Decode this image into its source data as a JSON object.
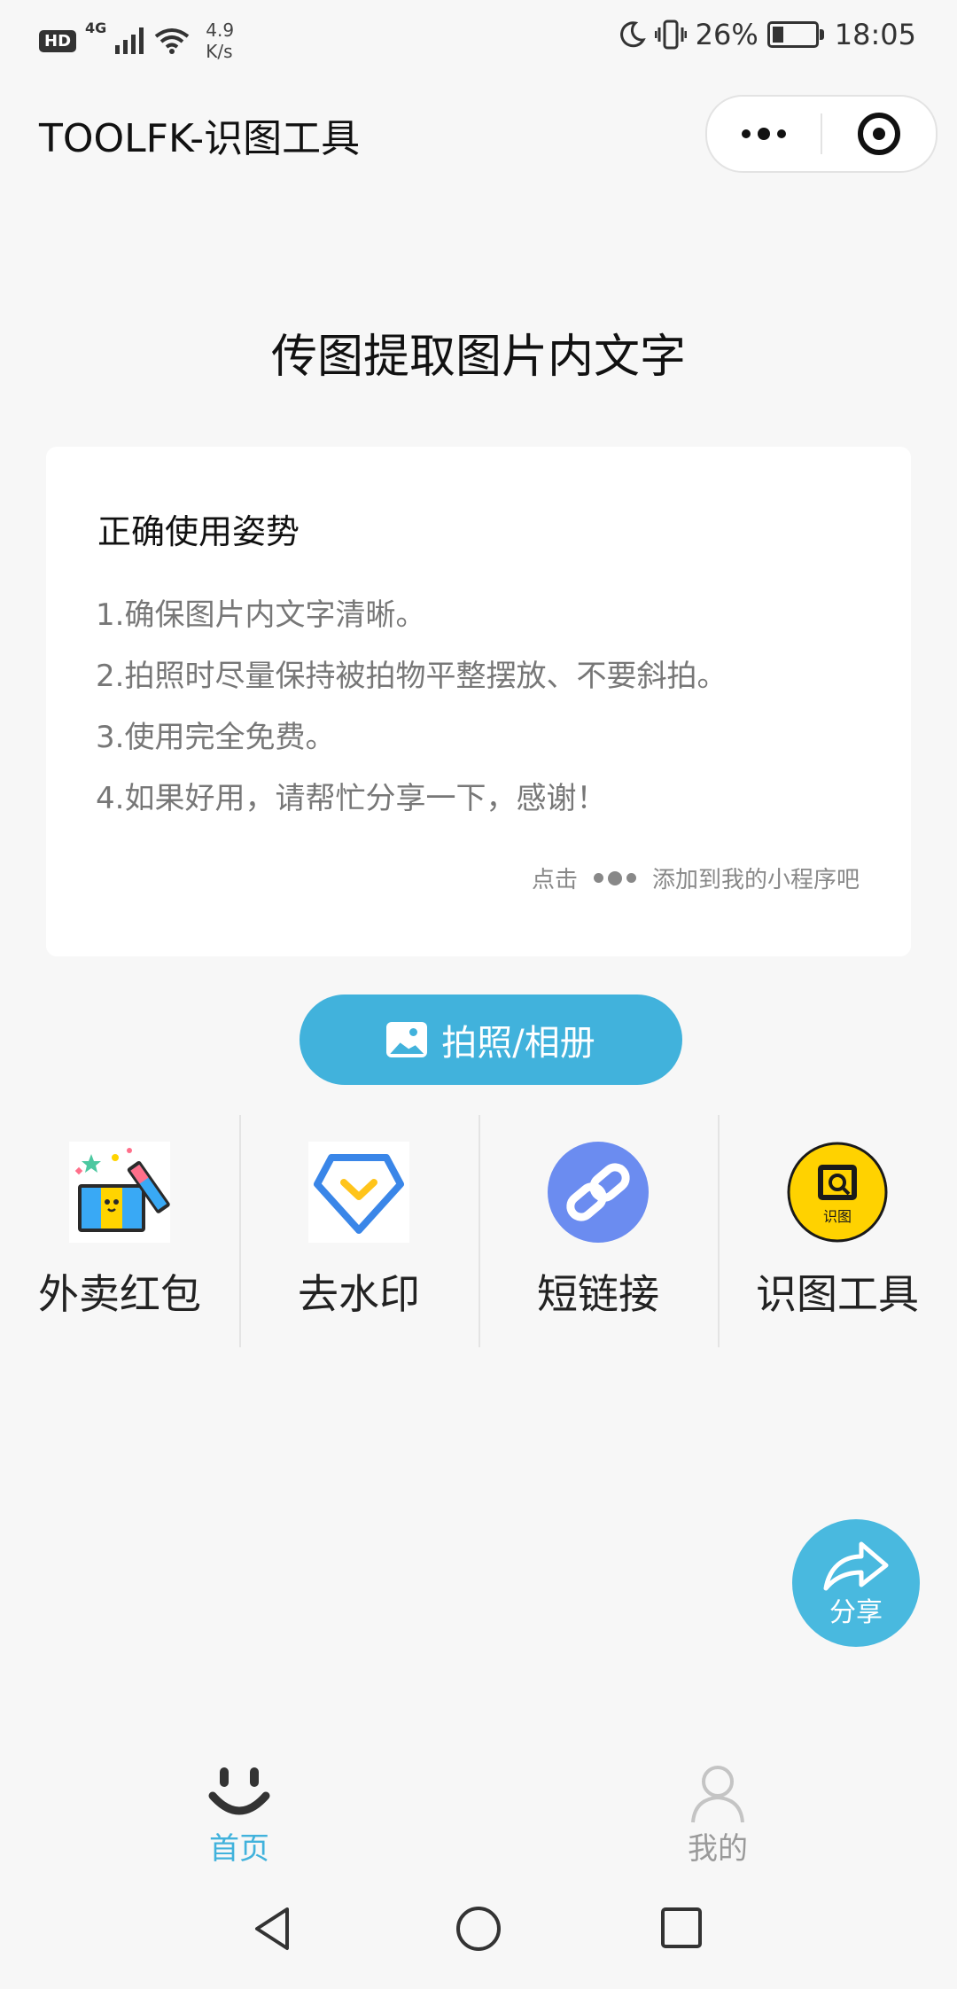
{
  "status_bar": {
    "hd": "HD",
    "network": "4G",
    "speed_value": "4.9",
    "speed_unit": "K/s",
    "battery": "26%",
    "battery_level": 0.26,
    "time": "18:05"
  },
  "header": {
    "title": "TOOLFK-识图工具",
    "more_icon": "more-dots-icon",
    "close_icon": "target-close-icon"
  },
  "headline": "传图提取图片内文字",
  "tips_card": {
    "title": "正确使用姿势",
    "items": [
      "1.确保图片内文字清晰。",
      "2.拍照时尽量保持被拍物平整摆放、不要斜拍。",
      "3.使用完全免费。",
      "4.如果好用，请帮忙分享一下，感谢！"
    ],
    "hint_prefix": "点击",
    "hint_suffix": "添加到我的小程序吧"
  },
  "photo_button": {
    "label": "拍照/相册",
    "icon": "image-icon"
  },
  "tools": [
    {
      "label": "外卖红包",
      "icon": "gift-box-icon"
    },
    {
      "label": "去水印",
      "icon": "diamond-check-icon"
    },
    {
      "label": "短链接",
      "icon": "link-icon"
    },
    {
      "label": "识图工具",
      "icon": "scan-image-icon",
      "icon_text": "识图"
    }
  ],
  "share_fab": {
    "label": "分享",
    "icon": "share-arrow-icon"
  },
  "tabbar": [
    {
      "label": "首页",
      "icon": "smile-icon",
      "active": true
    },
    {
      "label": "我的",
      "icon": "user-icon",
      "active": false
    }
  ],
  "colors": {
    "accent": "#41b2dc",
    "fab": "#49b9df",
    "link_icon": "#6b8cf0",
    "scan_icon": "#ffd200"
  }
}
